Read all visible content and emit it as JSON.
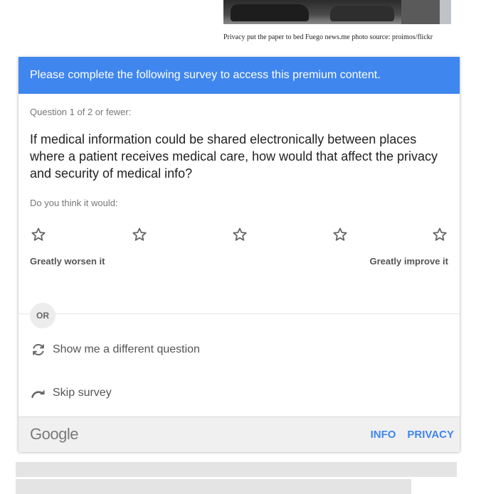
{
  "photo": {
    "caption": "Privacy put the paper to bed Fuego news.me photo source: proimos/flickr"
  },
  "survey": {
    "header": "Please complete the following survey to access this premium content.",
    "question_count": "Question 1 of 2 or fewer:",
    "question": "If medical information could be shared electronically between places where a patient receives medical care, how would that affect the privacy and security of medical info?",
    "prompt": "Do you think it would:",
    "rating": {
      "max": 5,
      "selected": 0
    },
    "label_low": "Greatly worsen it",
    "label_high": "Greatly improve it",
    "or_label": "OR",
    "different_question": "Show me a different question",
    "skip": "Skip survey"
  },
  "footer": {
    "logo": "Google",
    "info": "INFO",
    "privacy": "PRIVACY"
  },
  "colors": {
    "accent": "#3f86ee",
    "icon": "#666666"
  }
}
